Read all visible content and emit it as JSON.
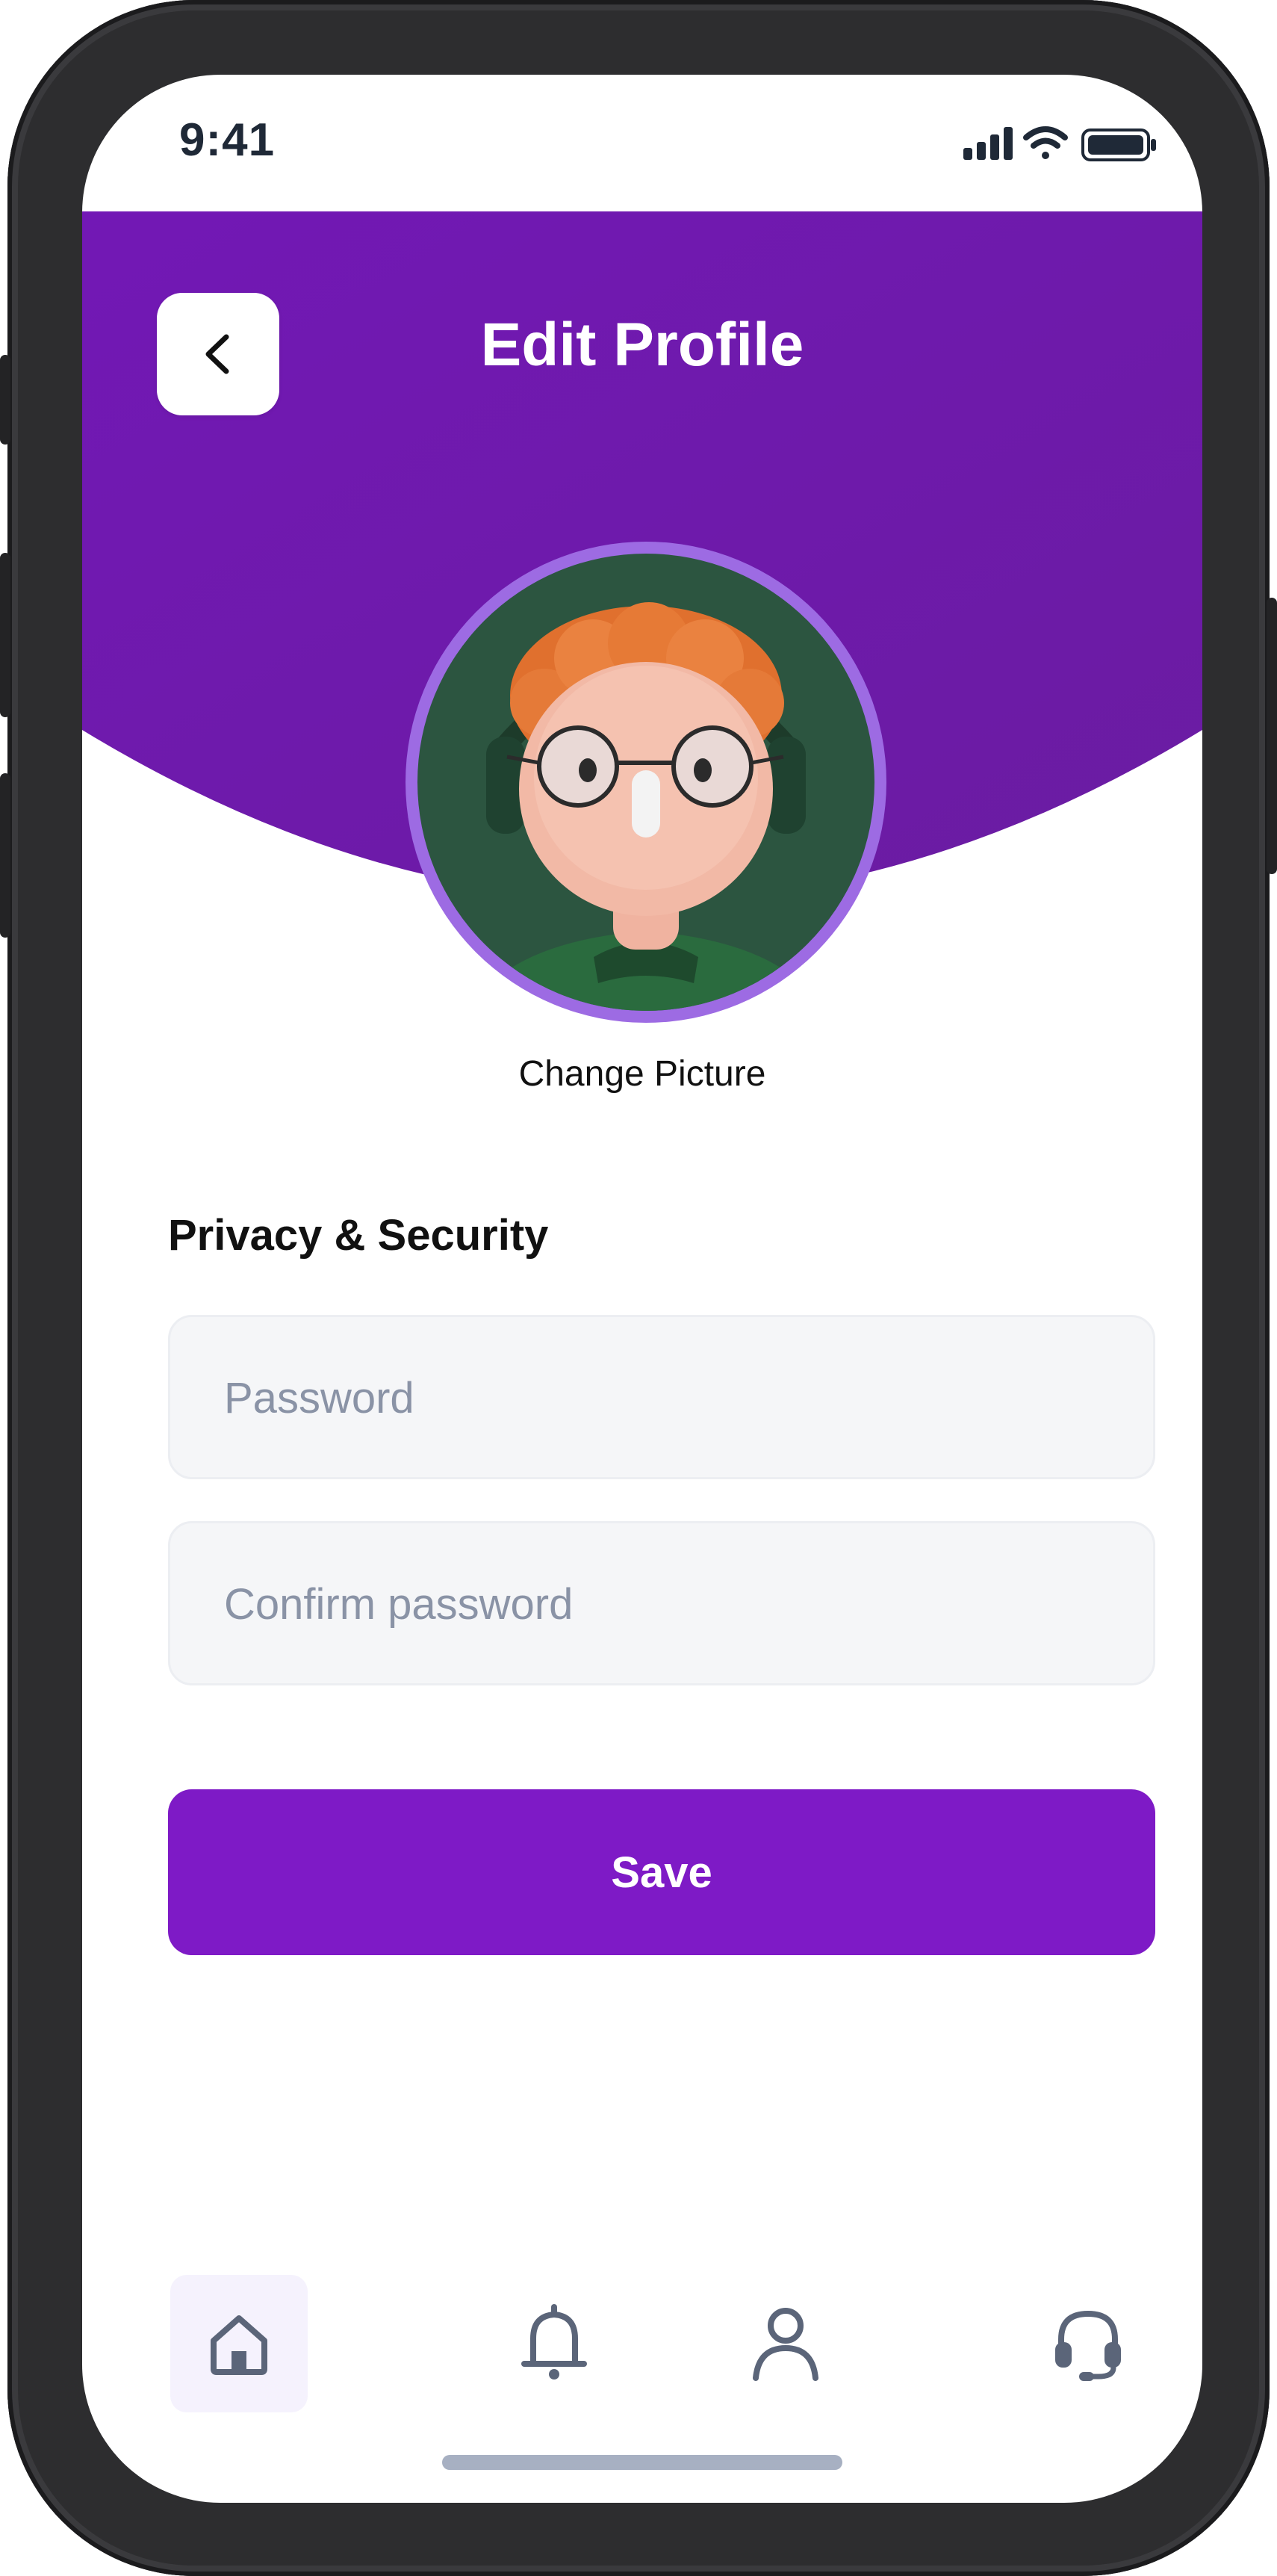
{
  "status_bar": {
    "time": "9:41"
  },
  "header": {
    "title": "Edit Profile",
    "back_icon": "chevron-left-icon"
  },
  "profile": {
    "change_picture_label": "Change Picture"
  },
  "form": {
    "section_title": "Privacy & Security",
    "password_placeholder": "Password",
    "confirm_placeholder": "Confirm password",
    "save_label": "Save"
  },
  "bottom_nav": {
    "items": [
      {
        "icon": "home-icon",
        "active": true
      },
      {
        "icon": "bell-icon",
        "active": false
      },
      {
        "icon": "user-icon",
        "active": false
      },
      {
        "icon": "headset-icon",
        "active": false
      }
    ]
  },
  "colors": {
    "header_gradient_start": "#7218b5",
    "header_gradient_end": "#6a1ca1",
    "primary_button": "#7e1ac6",
    "avatar_ring": "#9d6be3",
    "avatar_background": "#2c5540",
    "nav_icon": "#5b6579"
  }
}
